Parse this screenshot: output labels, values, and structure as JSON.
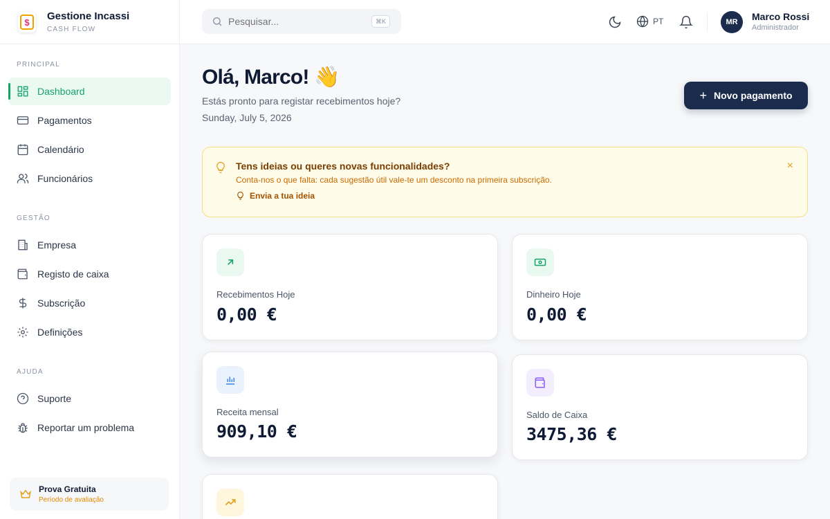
{
  "brand": {
    "title": "Gestione Incassi",
    "subtitle": "CASH FLOW"
  },
  "sidebar": {
    "sections": [
      "PRINCIPAL",
      "GESTÃO",
      "AJUDA"
    ],
    "items": [
      {
        "label": "Dashboard",
        "icon": "dashboard-icon",
        "active": true
      },
      {
        "label": "Pagamentos",
        "icon": "credit-card-icon"
      },
      {
        "label": "Calendário",
        "icon": "calendar-icon"
      },
      {
        "label": "Funcionários",
        "icon": "users-icon"
      },
      {
        "label": "Empresa",
        "icon": "building-icon"
      },
      {
        "label": "Registo de caixa",
        "icon": "wallet-icon"
      },
      {
        "label": "Subscrição",
        "icon": "dollar-icon"
      },
      {
        "label": "Definições",
        "icon": "gear-icon"
      },
      {
        "label": "Suporte",
        "icon": "help-circle-icon"
      },
      {
        "label": "Reportar um problema",
        "icon": "bug-icon"
      }
    ],
    "trial": {
      "title": "Prova Gratuita",
      "subtitle": "Período de avaliação"
    }
  },
  "header": {
    "search_placeholder": "Pesquisar...",
    "shortcut": "⌘K",
    "language": "PT",
    "user": {
      "initials": "MR",
      "name": "Marco Rossi",
      "role": "Administrador"
    }
  },
  "main": {
    "greeting": "Olá, Marco! 👋",
    "subtitle": "Estás pronto para registar recebimentos hoje?",
    "date": "Sunday, July 5, 2026",
    "new_payment_label": "Novo pagamento",
    "banner": {
      "title": "Tens ideias ou queres novas funcionalidades?",
      "text": "Conta-nos o que falta: cada sugestão útil vale-te um desconto na primeira subscrição.",
      "link": "Envia a tua ideia",
      "close": "×"
    },
    "cards": [
      {
        "label": "Recebimentos Hoje",
        "value": "0,00 €",
        "icon": "arrow-up-right-icon",
        "color": "#16a36a"
      },
      {
        "label": "Dinheiro Hoje",
        "value": "0,00 €",
        "icon": "banknote-icon",
        "color": "#16a36a"
      },
      {
        "label": "Receita mensal",
        "value": "909,10 €",
        "icon": "bar-chart-icon",
        "color": "#3b82f6"
      },
      {
        "label": "Saldo de Caixa",
        "value": "3475,36 €",
        "icon": "wallet-icon",
        "color": "#8b5cf6"
      },
      {
        "label": "",
        "value": "",
        "icon": "trending-up-icon",
        "color": "#e0a020"
      }
    ]
  }
}
